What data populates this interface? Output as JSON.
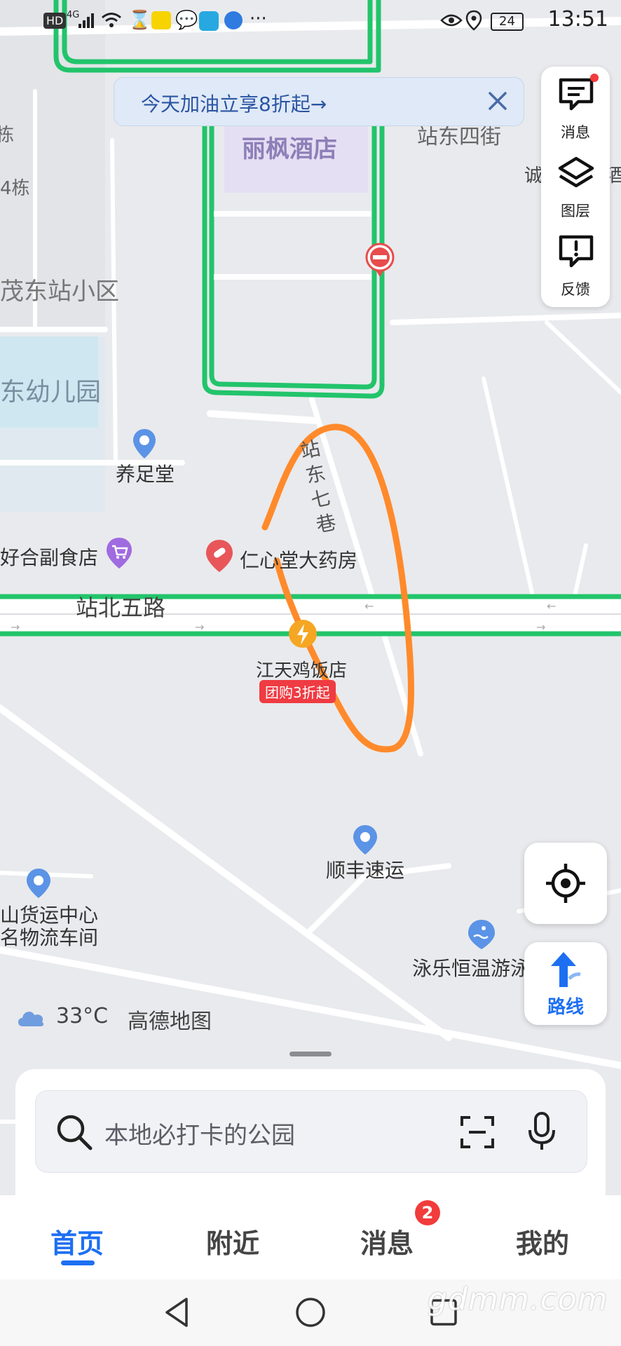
{
  "status_bar": {
    "network": "4G",
    "hd": "HD",
    "battery": "24",
    "time": "13:51",
    "dots": "···"
  },
  "banner": {
    "text": "今天加油立享8折起→"
  },
  "side_panel": {
    "messages_label": "消息",
    "layers_label": "图层",
    "feedback_label": "反馈"
  },
  "map": {
    "labels": {
      "hotel": "丽枫酒店",
      "zhandong_4th": "站东四街",
      "cheng": "诚",
      "jiu": "酒",
      "dong": "栋",
      "building4": "4栋",
      "maodong_community": "茂东站小区",
      "kindergarten": "东幼儿园",
      "foot_massage": "养足堂",
      "zhandong_7th_lane": "站东七巷",
      "grocery": "好合副食店",
      "pharmacy": "仁心堂大药房",
      "road_zhanbei5": "站北五路",
      "chicken_shop": "江天鸡饭店",
      "groupbuy_tag": "团购3折起",
      "sf_express": "顺丰速运",
      "freight_center_1": "山货运中心",
      "freight_center_2": "名物流车间",
      "swimming": "泳乐恒温游泳"
    },
    "weather_temp": "33°C",
    "brand": "高德地图",
    "route_button": "路线"
  },
  "search": {
    "placeholder": "本地必打卡的公园"
  },
  "tabs": [
    {
      "label": "首页",
      "active": true
    },
    {
      "label": "附近",
      "active": false
    },
    {
      "label": "消息",
      "active": false,
      "badge": "2"
    },
    {
      "label": "我的",
      "active": false
    }
  ],
  "watermark": "gdmm.com",
  "colors": {
    "route_green": "#22c46b",
    "accent_blue": "#1d6ff2",
    "annotation_orange": "#ff8a2b",
    "badge_red": "#f23b3b"
  }
}
